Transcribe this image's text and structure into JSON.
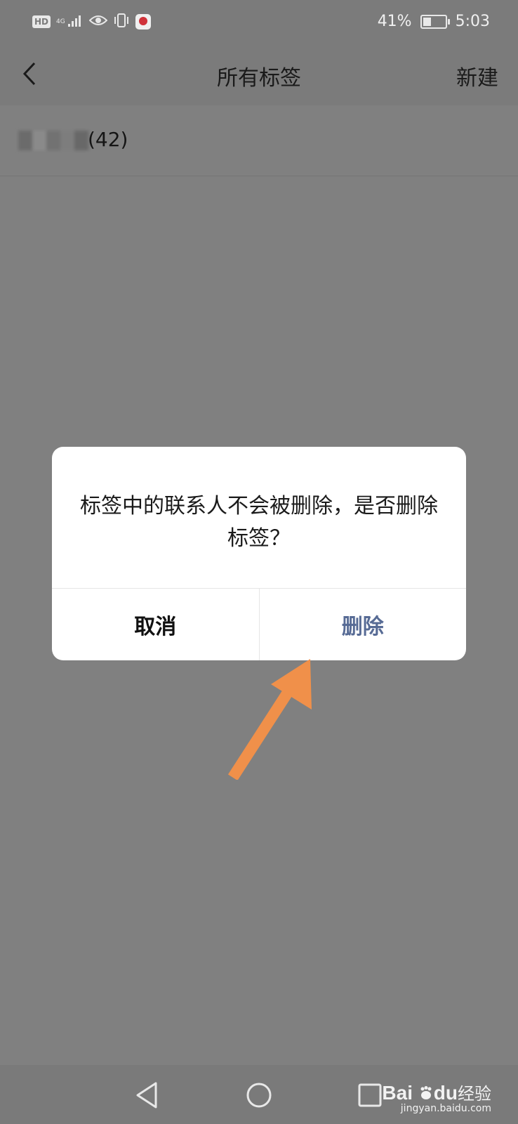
{
  "status_bar": {
    "hd": "HD",
    "network": "4G",
    "battery_percent": "41%",
    "battery_level": 0.41,
    "time": "5:03",
    "icons": [
      "hd-icon",
      "signal-icon",
      "eye-icon",
      "vibrate-icon",
      "app-notification-icon",
      "battery-icon"
    ]
  },
  "nav": {
    "title": "所有标签",
    "new_label": "新建",
    "back_icon": "chevron-left-icon"
  },
  "tags": [
    {
      "name": "",
      "count_text": "(42)"
    }
  ],
  "dialog": {
    "message": "标签中的联系人不会被删除，是否删除标签？",
    "cancel_label": "取消",
    "delete_label": "删除",
    "delete_color": "#576b95"
  },
  "annotation": {
    "arrow_color": "#f0904a"
  },
  "system_nav": {
    "icons": [
      "back-triangle-icon",
      "home-circle-icon",
      "recents-square-icon"
    ]
  },
  "watermark": {
    "brand": "Bai",
    "brand_mid": "du",
    "brand_suffix": "经验",
    "url": "jingyan.baidu.com"
  }
}
